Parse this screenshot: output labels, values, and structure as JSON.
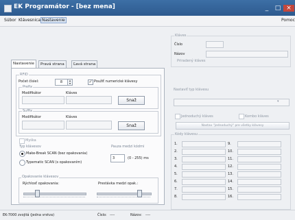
{
  "window": {
    "title": "EK Programátor - [bez mena]"
  },
  "menubar": {
    "items": [
      "Súbor",
      "Klávesnica",
      "Nastavenie"
    ],
    "help": "Pomoc"
  },
  "tabs": [
    "Nastavenie",
    "Pravá strana",
    "Ľavá strana"
  ],
  "rfid": {
    "group_label": "RFID",
    "digits_label": "Počet čísiel:",
    "digits_value": "8",
    "numeric_keys_label": "Použiť numerické klávesy",
    "numeric_keys_checked": true
  },
  "prefix": {
    "group_label": "Prefix",
    "modifier_label": "Modifikátor",
    "key_label": "Kláves",
    "record_button": "Snaž"
  },
  "suffix": {
    "group_label": "Suffix",
    "modifier_label": "Modifikátor",
    "key_label": "Kláves",
    "record_button": "Snaž"
  },
  "mouse_label": "Myška",
  "key_type": {
    "group_label": "Typ klávesov",
    "options": [
      "Make-Break SCAN (bez opakovania)",
      "Typematic SCAN (s opakovaním)"
    ],
    "selected_index": 0
  },
  "pause": {
    "label": "Pauza medzi kódmi",
    "value": "3",
    "range_label": "(0 - 255) ms"
  },
  "repeat": {
    "group_label": "Opakovanie klávesov",
    "speed_label": "Rýchlosť opakovania:",
    "delay_label": "Prestávka medzi opak.:",
    "speed_level": 0.22,
    "delay_level": 0.8
  },
  "right": {
    "key_group_label": "Kláves",
    "number_label": "Číslo",
    "name_label": "Názov",
    "assigned_label": "Priradený kláves",
    "keyboard_type_label": "Nastaviť typ klávesu",
    "single_key_label": "Jednoduchý kláves",
    "combo_key_label": "Kombo kláves",
    "set_single_button": "Nastav \"jednoduchý\" pre všetky klávesy",
    "codes_group_label": "Kódy klávesu",
    "codes_left": [
      "1.",
      "2.",
      "3.",
      "4.",
      "5.",
      "6.",
      "7.",
      "8."
    ],
    "codes_right": [
      "9.",
      "10.",
      "11.",
      "12.",
      "13.",
      "14.",
      "15.",
      "16."
    ]
  },
  "status": {
    "model": "EK-7000 zvojitá (jedna vrstva)",
    "number_label": "Číslo:",
    "number_value": "----",
    "name_label": "Názov:",
    "name_value": "----"
  },
  "colors": {
    "titlebar": "#2d5a8e",
    "close": "#c4473c"
  }
}
